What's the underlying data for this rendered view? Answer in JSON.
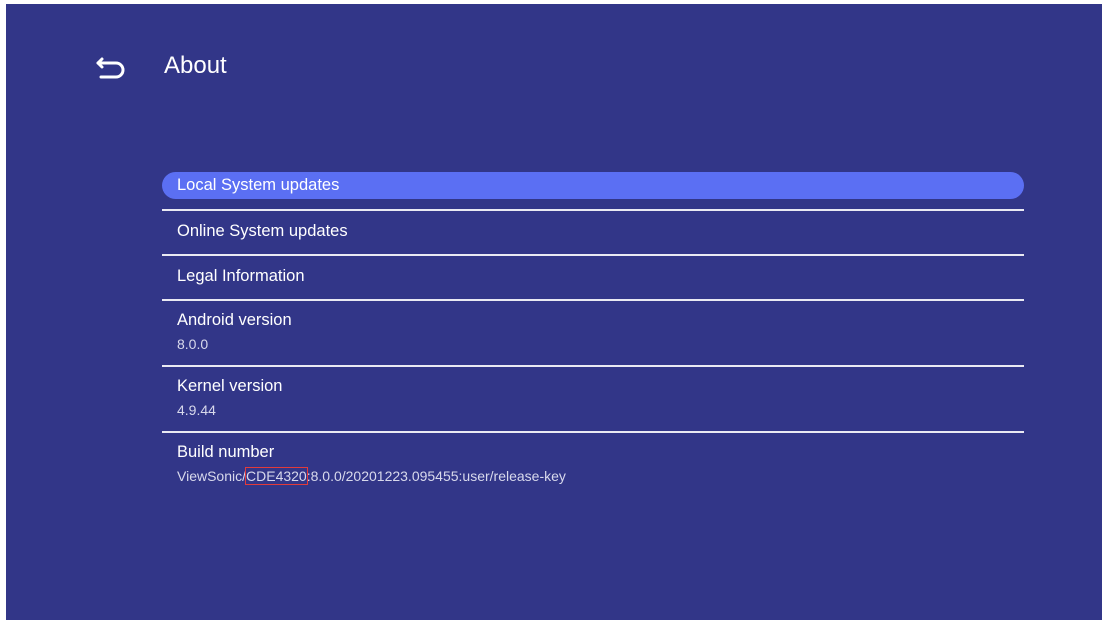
{
  "header": {
    "title": "About",
    "back_icon": "back-arrow-icon"
  },
  "menu": {
    "local_updates": "Local System updates",
    "online_updates": "Online System updates",
    "legal": "Legal Information",
    "android_label": "Android version",
    "android_value": "8.0.0",
    "kernel_label": "Kernel version",
    "kernel_value": "4.9.44",
    "build_label": "Build number",
    "build_prefix": "ViewSonic/",
    "build_model": "CDE4320",
    "build_suffix": ":8.0.0/20201223.095455:user/release-key"
  },
  "colors": {
    "background": "#323688",
    "selected_item": "#5b6ff3",
    "divider": "#e9e9f3",
    "annotation_box": "#e23b3b"
  }
}
